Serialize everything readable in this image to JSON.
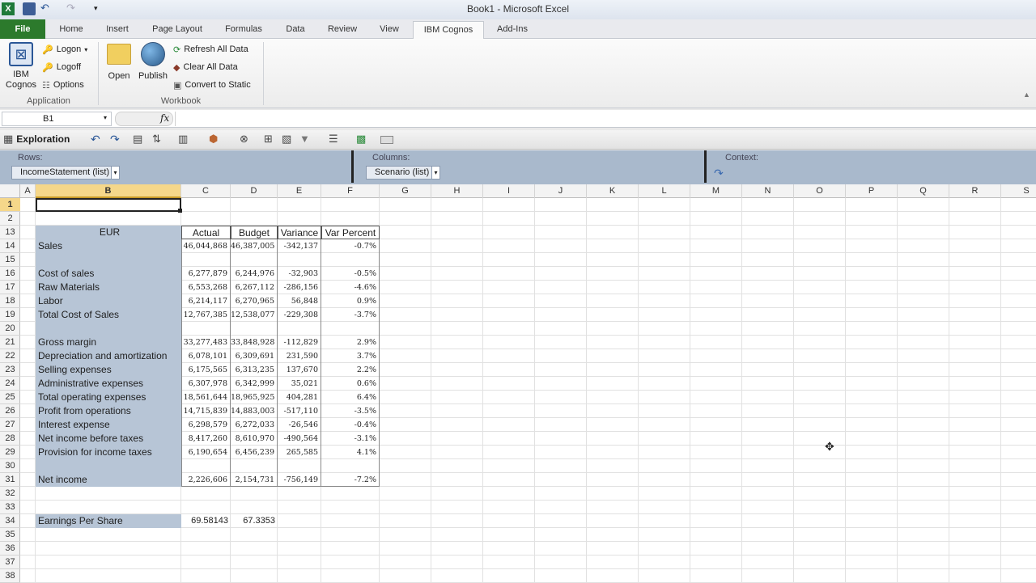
{
  "window": {
    "title": "Book1  -  Microsoft Excel"
  },
  "ribbon": {
    "tabs": [
      "File",
      "Home",
      "Insert",
      "Page Layout",
      "Formulas",
      "Data",
      "Review",
      "View",
      "IBM Cognos",
      "Add-Ins"
    ],
    "active_tab": "IBM Cognos",
    "application_group": {
      "label": "Application",
      "cognos_label_1": "IBM",
      "cognos_label_2": "Cognos",
      "logon": "Logon",
      "logoff": "Logoff",
      "options": "Options"
    },
    "workbook_group": {
      "label": "Workbook",
      "open": "Open",
      "publish": "Publish",
      "refresh": "Refresh All Data",
      "clear": "Clear All Data",
      "convert": "Convert to Static"
    }
  },
  "formula_bar": {
    "name_box": "B1",
    "fx": "fx",
    "value": ""
  },
  "exploration": {
    "label": "Exploration"
  },
  "drop_zones": {
    "rows_label": "Rows:",
    "rows_value": "IncomeStatement (list)",
    "columns_label": "Columns:",
    "columns_value": "Scenario (list)",
    "context_label": "Context:"
  },
  "columns": [
    "A",
    "B",
    "C",
    "D",
    "E",
    "F",
    "G",
    "H",
    "I",
    "J",
    "K",
    "L",
    "M",
    "N",
    "O",
    "P",
    "Q",
    "R",
    "S"
  ],
  "row_numbers": [
    "1",
    "2",
    "13",
    "14",
    "15",
    "16",
    "17",
    "18",
    "19",
    "20",
    "21",
    "22",
    "23",
    "24",
    "25",
    "26",
    "27",
    "28",
    "29",
    "30",
    "31",
    "32",
    "33",
    "34",
    "35",
    "36",
    "37",
    "38"
  ],
  "table": {
    "header": {
      "currency": "EUR",
      "actual": "Actual",
      "budget": "Budget",
      "variance": "Variance",
      "var_percent": "Var Percent"
    },
    "rows": [
      {
        "label": "Sales",
        "actual": "46,044,868",
        "budget": "46,387,005",
        "variance": "-342,137",
        "pct": "-0.7%"
      },
      {
        "label": "",
        "actual": "",
        "budget": "",
        "variance": "",
        "pct": ""
      },
      {
        "label": "Cost of sales",
        "actual": "6,277,879",
        "budget": "6,244,976",
        "variance": "-32,903",
        "pct": "-0.5%"
      },
      {
        "label": "Raw Materials",
        "actual": "6,553,268",
        "budget": "6,267,112",
        "variance": "-286,156",
        "pct": "-4.6%"
      },
      {
        "label": "Labor",
        "actual": "6,214,117",
        "budget": "6,270,965",
        "variance": "56,848",
        "pct": "0.9%"
      },
      {
        "label": "Total Cost of Sales",
        "actual": "12,767,385",
        "budget": "12,538,077",
        "variance": "-229,308",
        "pct": "-3.7%"
      },
      {
        "label": "",
        "actual": "",
        "budget": "",
        "variance": "",
        "pct": ""
      },
      {
        "label": "Gross margin",
        "actual": "33,277,483",
        "budget": "33,848,928",
        "variance": "-112,829",
        "pct": "2.9%"
      },
      {
        "label": "Depreciation and amortization",
        "actual": "6,078,101",
        "budget": "6,309,691",
        "variance": "231,590",
        "pct": "3.7%"
      },
      {
        "label": "Selling expenses",
        "actual": "6,175,565",
        "budget": "6,313,235",
        "variance": "137,670",
        "pct": "2.2%"
      },
      {
        "label": "Administrative expenses",
        "actual": "6,307,978",
        "budget": "6,342,999",
        "variance": "35,021",
        "pct": "0.6%"
      },
      {
        "label": "Total operating expenses",
        "actual": "18,561,644",
        "budget": "18,965,925",
        "variance": "404,281",
        "pct": "6.4%"
      },
      {
        "label": "Profit from operations",
        "actual": "14,715,839",
        "budget": "14,883,003",
        "variance": "-517,110",
        "pct": "-3.5%"
      },
      {
        "label": "Interest expense",
        "actual": "6,298,579",
        "budget": "6,272,033",
        "variance": "-26,546",
        "pct": "-0.4%"
      },
      {
        "label": "Net income before taxes",
        "actual": "8,417,260",
        "budget": "8,610,970",
        "variance": "-490,564",
        "pct": "-3.1%"
      },
      {
        "label": "Provision for income taxes",
        "actual": "6,190,654",
        "budget": "6,456,239",
        "variance": "265,585",
        "pct": "4.1%"
      },
      {
        "label": "",
        "actual": "",
        "budget": "",
        "variance": "",
        "pct": ""
      },
      {
        "label": "Net income",
        "actual": "2,226,606",
        "budget": "2,154,731",
        "variance": "-756,149",
        "pct": "-7.2%"
      }
    ],
    "eps": {
      "label": "Earnings Per Share",
      "actual": "69.58143",
      "budget": "67.3353"
    }
  }
}
